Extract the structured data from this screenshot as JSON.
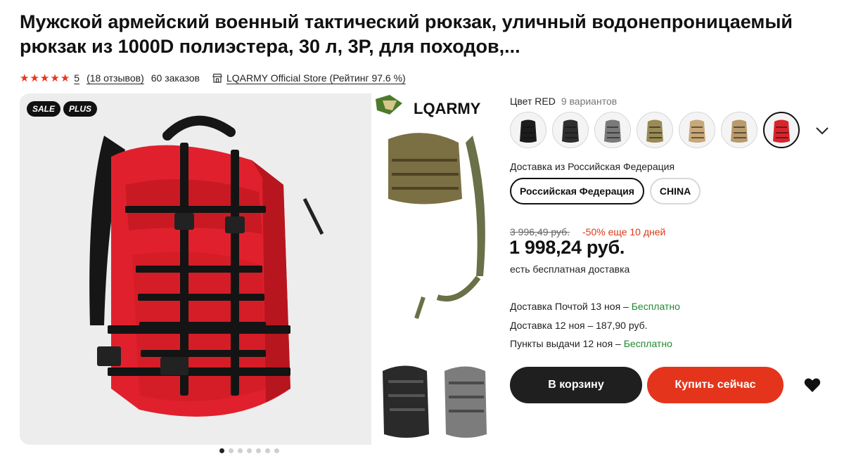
{
  "product": {
    "title": "Мужской армейский военный тактический рюкзак, уличный водонепроницаемый рюкзак из 1000D полиэстера, 30 л, 3P, для походов,..."
  },
  "meta": {
    "rating": "5",
    "reviews": "(18 отзывов)",
    "orders": "60 заказов",
    "store": "LQARMY Official Store (Рейтинг 97.6 %)"
  },
  "badges": [
    "SALE",
    "PLUS"
  ],
  "gallery": {
    "watermark": "LQARMY",
    "dot_count": 7,
    "active_dot": 0
  },
  "color": {
    "label": "Цвет RED",
    "variants_count": "9 вариантов",
    "swatches": [
      {
        "name": "black",
        "color": "#1c1c1c"
      },
      {
        "name": "black-camo",
        "color": "#2e2e2e"
      },
      {
        "name": "grey",
        "color": "#7a7a7a"
      },
      {
        "name": "olive",
        "color": "#9a8a55"
      },
      {
        "name": "desert-camo",
        "color": "#c8a878"
      },
      {
        "name": "tan-camo",
        "color": "#b89a6c"
      },
      {
        "name": "red",
        "color": "#d9242c"
      }
    ],
    "selected_index": 6
  },
  "shipping": {
    "label": "Доставка из Российская Федерация",
    "options": [
      "Российская Федерация",
      "CHINA"
    ],
    "selected_index": 0
  },
  "price": {
    "old": "3 996,49 руб.",
    "discount": "-50% еще 10 дней",
    "current": "1 998,24 руб.",
    "free_shipping": "есть бесплатная доставка"
  },
  "delivery": [
    {
      "text": "Доставка Почтой 13 ноя – ",
      "price": "Бесплатно",
      "free": true
    },
    {
      "text": "Доставка 12 ноя – ",
      "price": "187,90 руб.",
      "free": false
    },
    {
      "text": "Пункты выдачи 12 ноя – ",
      "price": "Бесплатно",
      "free": true
    }
  ],
  "actions": {
    "cart": "В корзину",
    "buy": "Купить сейчас"
  },
  "colors": {
    "accent": "#e4351c",
    "star": "#e8341c",
    "free": "#1f8a2e",
    "product_red": "#e0212d"
  }
}
